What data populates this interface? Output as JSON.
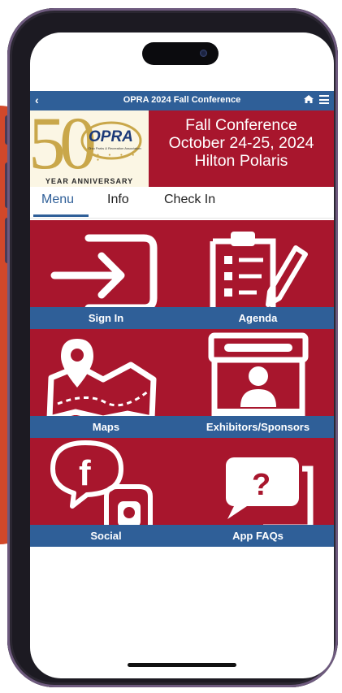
{
  "app": {
    "title": "OPRA 2024 Fall Conference",
    "back_icon": "chevron-left-icon",
    "home_icon": "home-icon",
    "menu_icon": "hamburger-icon"
  },
  "banner": {
    "logo": {
      "number": "50",
      "brand": "OPRA",
      "org": "Ohio Parks & Recreation Association",
      "anniversary": "YEAR ANNIVERSARY"
    },
    "line1": "Fall Conference",
    "line2": "October 24-25, 2024",
    "line3": "Hilton Polaris"
  },
  "tabs": [
    {
      "label": "Menu",
      "active": true
    },
    {
      "label": "Info",
      "active": false
    },
    {
      "label": "Check In",
      "active": false
    }
  ],
  "tiles": [
    {
      "label": "Sign In",
      "icon": "sign-in-icon"
    },
    {
      "label": "Agenda",
      "icon": "clipboard-icon"
    },
    {
      "label": "Maps",
      "icon": "map-icon"
    },
    {
      "label": "Exhibitors/Sponsors",
      "icon": "booth-icon"
    },
    {
      "label": "Social",
      "icon": "social-icon"
    },
    {
      "label": "App FAQs",
      "icon": "faq-icon"
    }
  ],
  "colors": {
    "brand_red": "#a8162d",
    "brand_blue": "#2f5f98",
    "gold": "#c9a74a"
  }
}
